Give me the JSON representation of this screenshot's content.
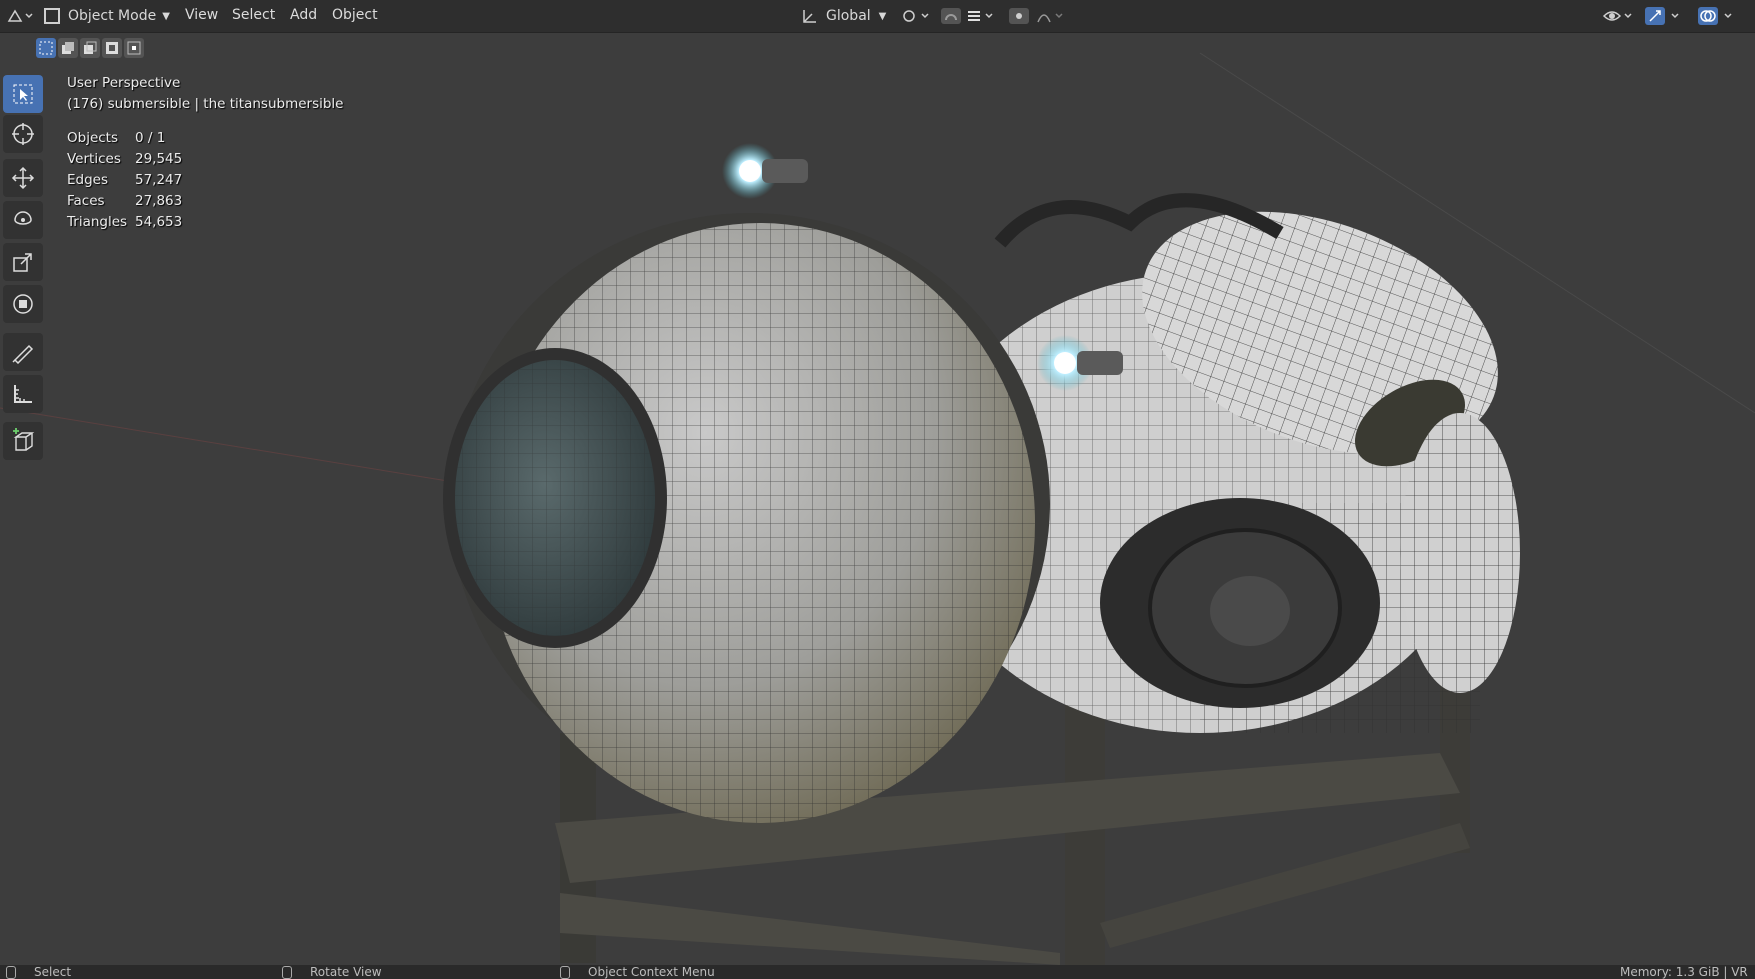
{
  "header": {
    "mode_label": "Object Mode",
    "menus": [
      "View",
      "Select",
      "Add",
      "Object"
    ],
    "orientation_label": "Global"
  },
  "viewport": {
    "view_name": "User Perspective",
    "object_info": "(176) submersible | the titansubmersible",
    "stats": [
      {
        "label": "Objects",
        "value": "0 / 1"
      },
      {
        "label": "Vertices",
        "value": "29,545"
      },
      {
        "label": "Edges",
        "value": "57,247"
      },
      {
        "label": "Faces",
        "value": "27,863"
      },
      {
        "label": "Triangles",
        "value": "54,653"
      }
    ]
  },
  "toolbar": {
    "tools": [
      "select-box-icon",
      "cursor-icon",
      "move-icon",
      "rotate-icon",
      "scale-icon",
      "transform-icon",
      "annotate-icon",
      "measure-icon",
      "add-cube-icon"
    ]
  },
  "statusbar": {
    "left": "Select",
    "middle": "Rotate View",
    "right_action": "Object Context Menu",
    "memory": "Memory: 1.3 GiB | VR"
  },
  "colors": {
    "accent": "#4772b3",
    "header_bg": "#2e2e2e",
    "viewport_bg": "#3d3d3d"
  }
}
